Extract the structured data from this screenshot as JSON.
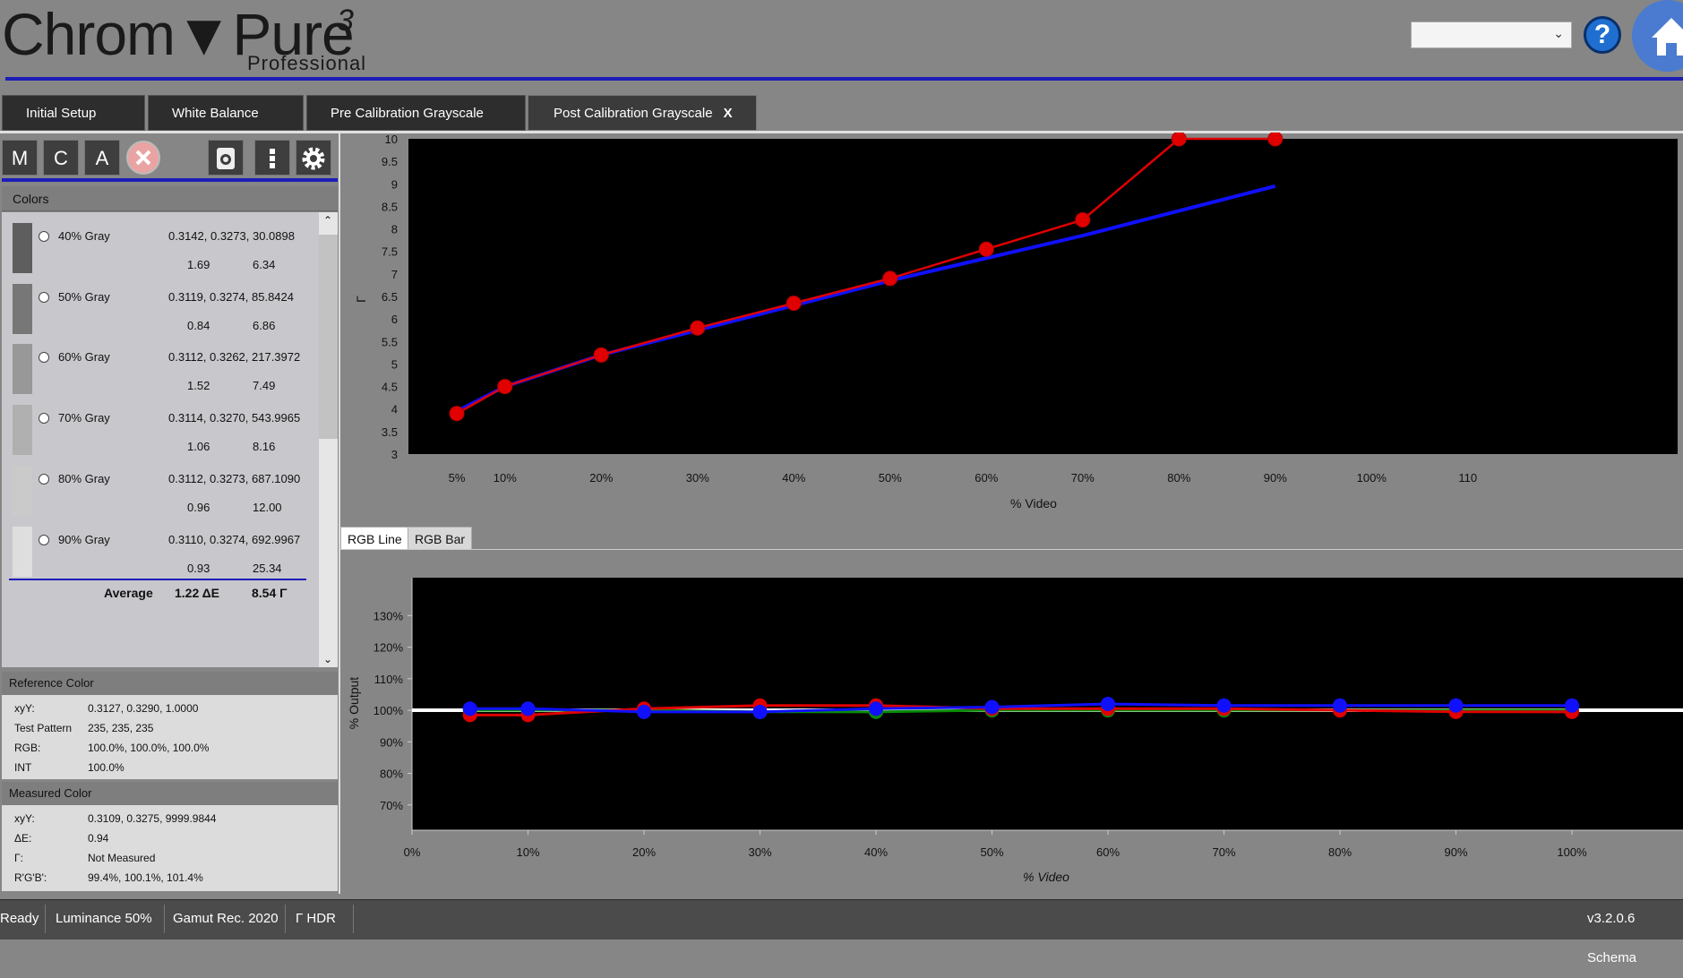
{
  "app": {
    "logo_main": "Chrom▼Pure",
    "logo_sup": "3",
    "logo_sub": "Professional",
    "profile_select_value": ""
  },
  "tabs": [
    {
      "label": "Initial Setup"
    },
    {
      "label": "White Balance"
    },
    {
      "label": "Pre Calibration Grayscale"
    },
    {
      "label": "Post Calibration Grayscale",
      "close": "X"
    }
  ],
  "toolbar": {
    "m": "M",
    "c": "C",
    "a": "A"
  },
  "colors": {
    "header": "Colors",
    "rows": [
      {
        "name": "40% Gray",
        "xyY": "0.3142, 0.3273, 30.0898",
        "de": "1.69",
        "gamma": "6.34",
        "swatch": "#5e5e5e"
      },
      {
        "name": "50% Gray",
        "xyY": "0.3119, 0.3274, 85.8424",
        "de": "0.84",
        "gamma": "6.86",
        "swatch": "#777777"
      },
      {
        "name": "60% Gray",
        "xyY": "0.3112, 0.3262, 217.3972",
        "de": "1.52",
        "gamma": "7.49",
        "swatch": "#989898"
      },
      {
        "name": "70% Gray",
        "xyY": "0.3114, 0.3270, 543.9965",
        "de": "1.06",
        "gamma": "8.16",
        "swatch": "#b0b0b0"
      },
      {
        "name": "80% Gray",
        "xyY": "0.3112, 0.3273, 687.1090",
        "de": "0.96",
        "gamma": "12.00",
        "swatch": "#cacaca"
      },
      {
        "name": "90% Gray",
        "xyY": "0.3110, 0.3274, 692.9967",
        "de": "0.93",
        "gamma": "25.34",
        "swatch": "#dedede"
      }
    ],
    "average_label": "Average",
    "average_de": "1.22 ΔE",
    "average_gamma": "8.54 Γ"
  },
  "reference": {
    "header": "Reference Color",
    "items": [
      {
        "k": "xyY:",
        "v": "0.3127, 0.3290, 1.0000"
      },
      {
        "k": "Test Pattern",
        "v": "235, 235, 235"
      },
      {
        "k": "RGB:",
        "v": "100.0%, 100.0%, 100.0%"
      },
      {
        "k": "INT",
        "v": "100.0%"
      }
    ]
  },
  "measured": {
    "header": "Measured Color",
    "items": [
      {
        "k": "xyY:",
        "v": "0.3109, 0.3275, 9999.9844"
      },
      {
        "k": "ΔE:",
        "v": "0.94"
      },
      {
        "k": "Γ:",
        "v": "Not Measured"
      },
      {
        "k": "R'G'B':",
        "v": "99.4%, 100.1%, 101.4%"
      }
    ]
  },
  "subtabs": [
    {
      "label": "RGB Line"
    },
    {
      "label": "RGB Bar"
    }
  ],
  "status": {
    "ready": "Ready",
    "luminance": "Luminance 50%",
    "gamut": "Gamut Rec. 2020",
    "gamma": "Γ HDR",
    "version": "v3.2.0.6 Schema"
  },
  "colors_accent": {
    "red": "#e00000",
    "blue": "#1010ff",
    "green": "#0a8a0a",
    "header_blue": "#1d1db8"
  },
  "chart_data": [
    {
      "type": "line",
      "title": "",
      "xlabel": "% Video",
      "ylabel": "Γ",
      "xlim": [
        0,
        110
      ],
      "ylim": [
        3,
        10
      ],
      "x_ticks": [
        "5%",
        "10%",
        "20%",
        "30%",
        "40%",
        "50%",
        "60%",
        "70%",
        "80%",
        "90%",
        "100%",
        "110"
      ],
      "x_tick_values": [
        5,
        10,
        20,
        30,
        40,
        50,
        60,
        70,
        80,
        90,
        100,
        110
      ],
      "y_ticks": [
        "3",
        "3.5",
        "4",
        "4.5",
        "5",
        "5.5",
        "6",
        "6.5",
        "7",
        "7.5",
        "8",
        "8.5",
        "9",
        "9.5",
        "10"
      ],
      "y_tick_values": [
        3,
        3.5,
        4,
        4.5,
        5,
        5.5,
        6,
        6.5,
        7,
        7.5,
        8,
        8.5,
        9,
        9.5,
        10
      ],
      "series": [
        {
          "color": "#1010ff",
          "markers": false,
          "x": [
            5,
            10,
            20,
            30,
            40,
            50,
            60,
            70,
            80,
            90
          ],
          "y": [
            3.95,
            4.5,
            5.2,
            5.75,
            6.3,
            6.85,
            7.35,
            7.85,
            8.4,
            8.95
          ]
        },
        {
          "color": "#e00000",
          "markers": true,
          "x": [
            5,
            10,
            20,
            30,
            40,
            50,
            60,
            70,
            80,
            90
          ],
          "y": [
            3.9,
            4.5,
            5.2,
            5.8,
            6.35,
            6.9,
            7.55,
            8.2,
            10,
            10
          ]
        }
      ]
    },
    {
      "type": "line",
      "title": "",
      "xlabel": "% Video",
      "ylabel": "% Output",
      "xlim": [
        0,
        110
      ],
      "ylim": [
        62,
        142
      ],
      "x_ticks": [
        "0%",
        "10%",
        "20%",
        "30%",
        "40%",
        "50%",
        "60%",
        "70%",
        "80%",
        "90%",
        "100%"
      ],
      "x_tick_values": [
        0,
        10,
        20,
        30,
        40,
        50,
        60,
        70,
        80,
        90,
        100
      ],
      "y_ticks": [
        "70%",
        "80%",
        "90%",
        "100%",
        "110%",
        "120%",
        "130%"
      ],
      "y_tick_values": [
        70,
        80,
        90,
        100,
        110,
        120,
        130
      ],
      "reference_line": 100,
      "series": [
        {
          "color": "#0a8a0a",
          "x": [
            5,
            10,
            20,
            30,
            40,
            50,
            60,
            70,
            80,
            90,
            100
          ],
          "y": [
            100,
            100,
            100,
            99.5,
            99.5,
            100,
            100,
            100,
            100,
            100,
            100
          ]
        },
        {
          "color": "#e00000",
          "x": [
            5,
            10,
            20,
            30,
            40,
            50,
            60,
            70,
            80,
            90,
            100
          ],
          "y": [
            98.5,
            98.5,
            100.5,
            101.5,
            101.5,
            100.5,
            100.5,
            100.5,
            100,
            99.5,
            99.5
          ]
        },
        {
          "color": "#1010ff",
          "x": [
            5,
            10,
            20,
            30,
            40,
            50,
            60,
            70,
            80,
            90,
            100
          ],
          "y": [
            100.5,
            100.5,
            99.5,
            99.5,
            100.5,
            101,
            102,
            101.5,
            101.5,
            101.5,
            101.5
          ]
        }
      ]
    }
  ]
}
